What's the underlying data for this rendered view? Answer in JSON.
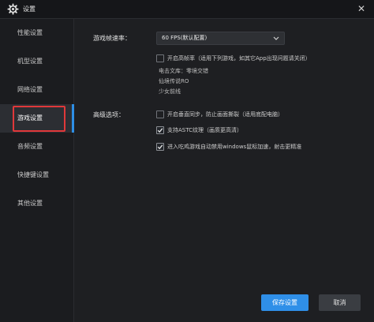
{
  "window": {
    "title": "设置",
    "close_glyph": "✕"
  },
  "sidebar": {
    "items": [
      {
        "label": "性能设置"
      },
      {
        "label": "机型设置"
      },
      {
        "label": "网络设置"
      },
      {
        "label": "游戏设置",
        "active": true
      },
      {
        "label": "音频设置"
      },
      {
        "label": "快捷键设置"
      },
      {
        "label": "其他设置"
      }
    ]
  },
  "fps": {
    "label": "游戏帧速率：",
    "selected": "60 FPS(默认配置)"
  },
  "high_fps": {
    "label": "开启高帧率（适用下列游戏，如其它App出现问题请关闭）",
    "checked": false,
    "games": [
      "电击文库：零境交错",
      "仙境传说RO",
      "少女前线"
    ]
  },
  "advanced": {
    "label": "高级选项：",
    "options": [
      {
        "label": "开启垂直同步，防止画面撕裂（适用底配电脑）",
        "checked": false
      },
      {
        "label": "支持ASTC纹理（画质更高清）",
        "checked": true
      },
      {
        "label": "进入吃鸡游戏自动禁用windows鼠标加速，射击更精准",
        "checked": true
      }
    ]
  },
  "buttons": {
    "save": "保存设置",
    "cancel": "取消"
  },
  "colors": {
    "accent": "#2e8fe6",
    "highlight_box": "#e0383a"
  },
  "icons": {
    "title": "gear-icon",
    "close": "close-icon",
    "dropdown": "chevron-down-icon",
    "check": "check-icon"
  }
}
